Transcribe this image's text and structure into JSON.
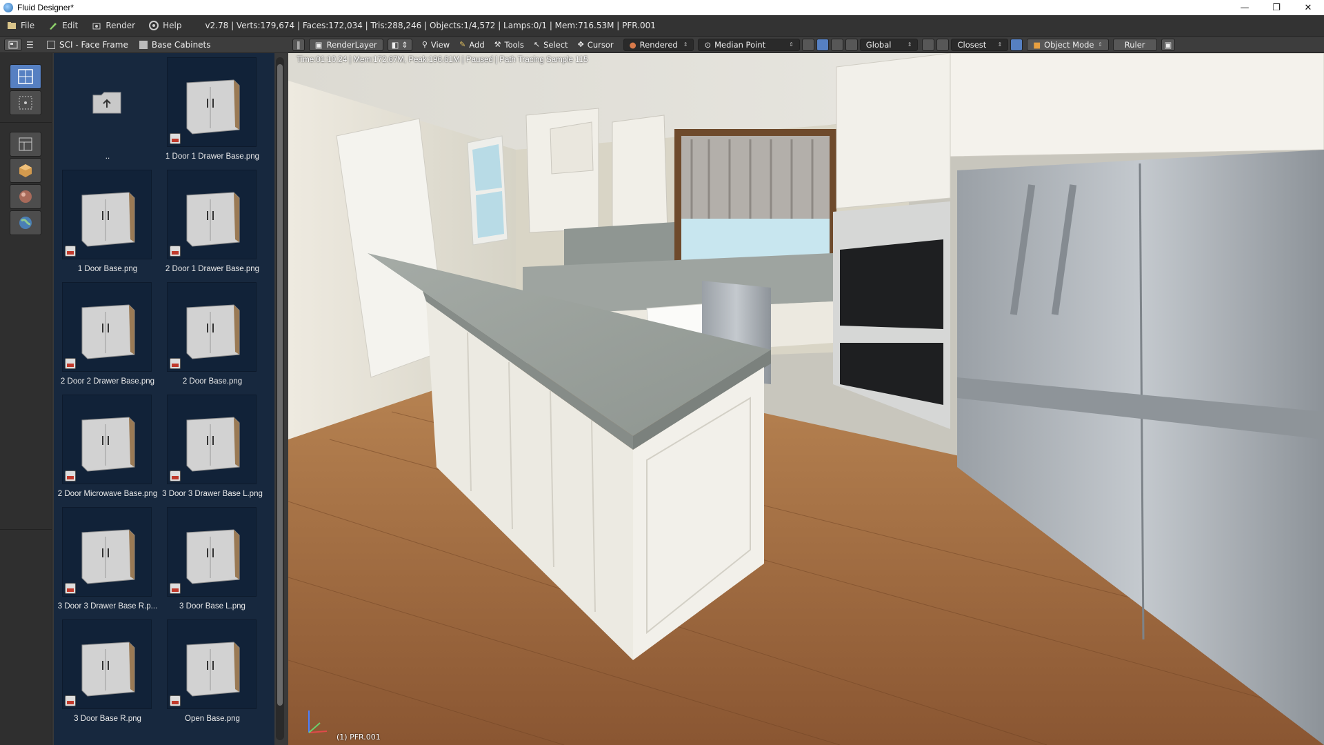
{
  "window": {
    "title": "Fluid Designer*",
    "controls": {
      "minimize": "—",
      "maximize": "❐",
      "close": "✕"
    }
  },
  "menubar": {
    "items": [
      {
        "label": "File",
        "icon": "file-icon"
      },
      {
        "label": "Edit",
        "icon": "edit-icon"
      },
      {
        "label": "Render",
        "icon": "render-icon"
      },
      {
        "label": "Help",
        "icon": "help-icon"
      }
    ],
    "stats": "v2.78 | Verts:179,674 | Faces:172,034 | Tris:288,246 | Objects:1/4,572 | Lamps:0/1 | Mem:716.53M | PFR.001"
  },
  "library": {
    "breadcrumb": [
      {
        "label": "SCI - Face Frame",
        "icon": "library-icon"
      },
      {
        "label": "Base Cabinets",
        "icon": "folder-icon"
      }
    ],
    "parent_label": "..",
    "files": [
      "1 Door 1 Drawer Base.png",
      "1 Door Base.png",
      "2 Door 1 Drawer Base.png",
      "2 Door 2 Drawer Base.png",
      "2 Door Base.png",
      "2 Door Microwave Base.png",
      "3 Door 3 Drawer Base L.png",
      "3 Door 3 Drawer Base R.p...",
      "3 Door Base L.png",
      "3 Door Base R.png",
      "Open Base.png"
    ]
  },
  "viewport_header": {
    "render_layer": "RenderLayer",
    "view": "View",
    "add": "Add",
    "tools": "Tools",
    "select": "Select",
    "cursor": "Cursor",
    "shading": "Rendered",
    "pivot": "Median Point",
    "orientation": "Global",
    "snap": "Closest",
    "mode": "Object Mode",
    "ruler": "Ruler"
  },
  "viewport": {
    "status": "Time:01:10.24 | Mem:172.67M, Peak:196.61M | Paused | Path Tracing Sample 115",
    "object_name": "(1) PFR.001"
  }
}
